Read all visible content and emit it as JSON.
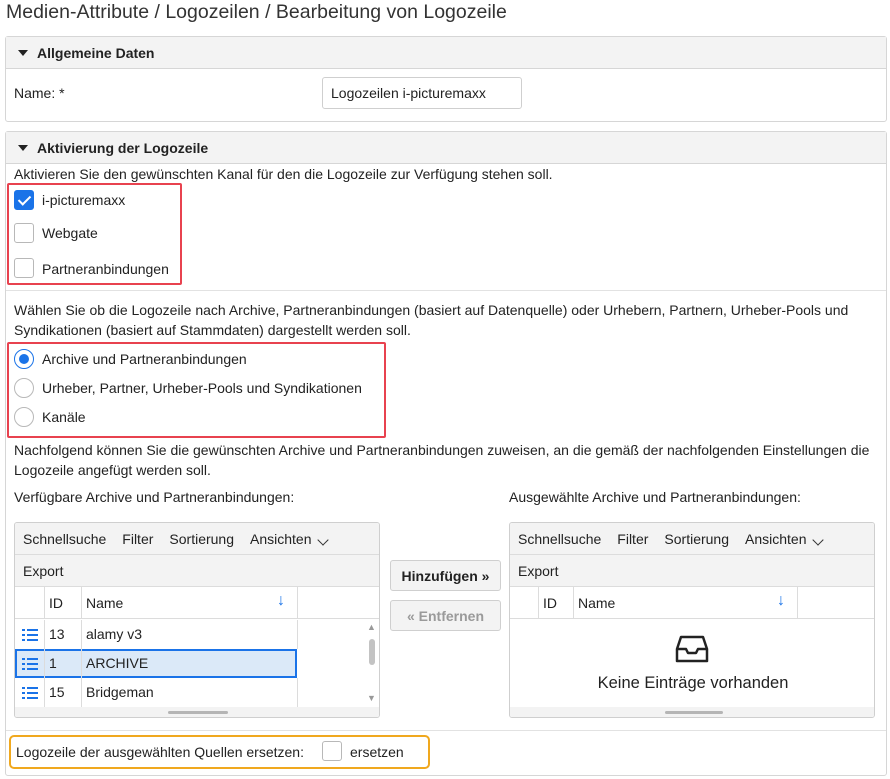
{
  "page": {
    "title": "Medien-Attribute / Logozeilen / Bearbeitung von Logozeile"
  },
  "general": {
    "header": "Allgemeine Daten",
    "name_label": "Name: *",
    "name_value": "Logozeilen i-picturemaxx"
  },
  "activation": {
    "header": "Aktivierung der Logozeile",
    "channel_intro": "Aktivieren Sie den gewünschten Kanal für den die Logozeile zur Verfügung stehen soll.",
    "channels": [
      {
        "label": "i-picturemaxx",
        "checked": true
      },
      {
        "label": "Webgate",
        "checked": false
      },
      {
        "label": "Partneranbindungen",
        "checked": false
      }
    ],
    "mode_intro_line1": "Wählen Sie ob die Logozeile nach Archive, Partneranbindungen (basiert auf Datenquelle) oder Urhebern, Partnern, Urheber-Pools und",
    "mode_intro_line2": "Syndikationen (basiert auf Stammdaten) dargestellt werden soll.",
    "modes": [
      {
        "label": "Archive und Partneranbindungen",
        "selected": true
      },
      {
        "label": "Urheber, Partner, Urheber-Pools und Syndikationen",
        "selected": false
      },
      {
        "label": "Kanäle",
        "selected": false
      }
    ],
    "assign_intro_line1": "Nachfolgend können Sie die gewünschten Archive und Partneranbindungen zuweisen, an die gemäß der nachfolgenden Einstellungen die",
    "assign_intro_line2": "Logozeile angefügt werden soll.",
    "available_label": "Verfügbare Archive und Partneranbindungen:",
    "selected_label": "Ausgewählte Archive und Partneranbindungen:",
    "toolbar": {
      "quicksearch": "Schnellsuche",
      "filter": "Filter",
      "sort": "Sortierung",
      "views": "Ansichten",
      "export": "Export"
    },
    "columns": {
      "id": "ID",
      "name": "Name"
    },
    "available_rows": [
      {
        "id": "13",
        "name": "alamy v3"
      },
      {
        "id": "1",
        "name": "ARCHIVE"
      },
      {
        "id": "15",
        "name": "Bridgeman"
      }
    ],
    "add_button": "Hinzufügen »",
    "remove_button": "« Entfernen",
    "empty_text": "Keine Einträge vorhanden",
    "replace_label": "Logozeile der ausgewählten Quellen ersetzen:",
    "replace_checkbox_label": "ersetzen",
    "replace_checked": false
  },
  "colors": {
    "accent": "#1a73e8",
    "highlight_red": "#e8424f",
    "highlight_orange": "#f0a81e",
    "selected_row": "#dbe9f8"
  }
}
